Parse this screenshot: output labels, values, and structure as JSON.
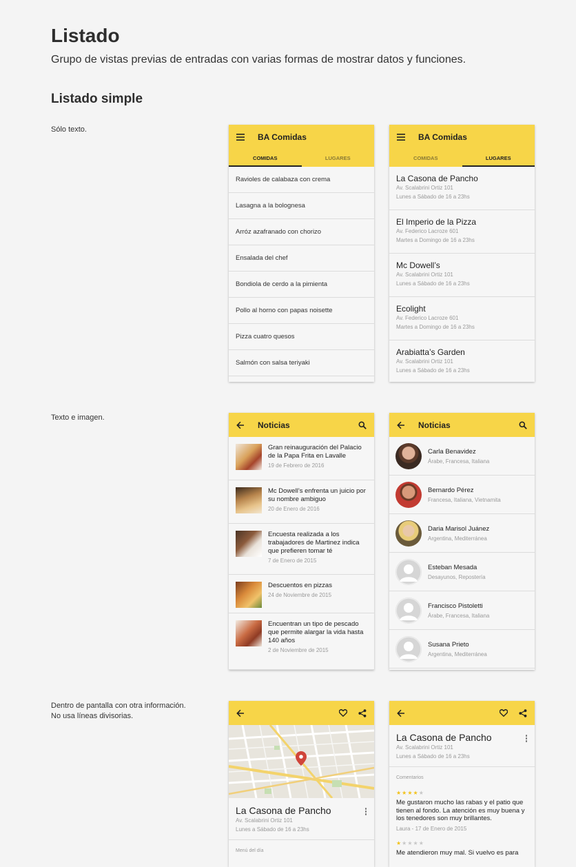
{
  "header": {
    "title": "Listado",
    "subtitle": "Grupo de vistas previas de entradas con varias formas de mostrar datos y funciones."
  },
  "section": {
    "title": "Listado simple"
  },
  "notes": {
    "text_only": "Sólo texto.",
    "text_image": "Texto e imagen.",
    "in_screen_1": "Dentro de pantalla con otra información.",
    "in_screen_2": "No usa líneas divisorias."
  },
  "colors": {
    "accent": "#f7d548",
    "background": "#f4f4f4",
    "star": "#f2c21a"
  },
  "phone1": {
    "title": "BA Comidas",
    "tabs": [
      "COMIDAS",
      "LUGARES"
    ],
    "items": [
      "Ravioles de calabaza con crema",
      "Lasagna a la bolognesa",
      "Arróz azafranado con chorizo",
      "Ensalada del chef",
      "Bondiola de cerdo a la pimienta",
      "Pollo al horno con papas noisette",
      "Pizza cuatro quesos",
      "Salmón con salsa teriyaki"
    ]
  },
  "phone2": {
    "title": "BA Comidas",
    "tabs": [
      "COMIDAS",
      "LUGARES"
    ],
    "items": [
      {
        "name": "La Casona de Pancho",
        "address": "Av. Scalabrini Ortiz 101",
        "hours": "Lunes a Sábado de 16 a 23hs"
      },
      {
        "name": "El Imperio de la Pizza",
        "address": "Av. Federico Lacroze 601",
        "hours": "Martes a Domingo de 16 a 23hs"
      },
      {
        "name": "Mc Dowell’s",
        "address": "Av. Scalabrini Ortiz 101",
        "hours": "Lunes a Sábado de 16 a 23hs"
      },
      {
        "name": "Ecolight",
        "address": "Av. Federico Lacroze 601",
        "hours": "Martes a Domingo de 16 a 23hs"
      },
      {
        "name": "Arabiatta’s Garden",
        "address": "Av. Scalabrini Ortiz 101",
        "hours": "Lunes a Sábado de 16 a 23hs"
      }
    ]
  },
  "phone3": {
    "title": "Noticias",
    "items": [
      {
        "title": "Gran reinauguración del Palacio de la Papa Frita en Lavalle",
        "date": "19 de Febrero de 2016"
      },
      {
        "title": "Mc Dowell’s enfrenta un juicio por su nombre ambiguo",
        "date": "20 de Enero de 2016"
      },
      {
        "title": "Encuesta realizada a los trabajadores de Martinez indica que prefieren tomar té",
        "date": "7 de Enero de 2015"
      },
      {
        "title": "Descuentos en pizzas",
        "date": "24 de Noviembre de 2015"
      },
      {
        "title": "Encuentran un tipo de pescado que permite alargar la vida hasta 140 años",
        "date": "2 de Noviembre de 2015"
      }
    ]
  },
  "phone4": {
    "title": "Noticias",
    "items": [
      {
        "name": "Carla Benavidez",
        "cuisines": "Árabe, Francesa, Italiana"
      },
      {
        "name": "Bernardo Pérez",
        "cuisines": "Francesa, Italiana, Vietnamita"
      },
      {
        "name": "Daria Marisol Juánez",
        "cuisines": "Argentina, Mediterránea"
      },
      {
        "name": "Esteban Mesada",
        "cuisines": "Desayunos, Repostería"
      },
      {
        "name": "Francisco Pistoletti",
        "cuisines": "Árabe, Francesa, Italiana"
      },
      {
        "name": "Susana Prieto",
        "cuisines": "Argentina, Mediterránea"
      }
    ]
  },
  "phone5": {
    "name": "La Casona de Pancho",
    "address": "Av. Scalabrini Ortiz 101",
    "hours": "Lunes a Sábado de 16 a 23hs",
    "menu_label": "Menú del día"
  },
  "phone6": {
    "name": "La Casona de Pancho",
    "address": "Av. Scalabrini Ortiz 101",
    "hours": "Lunes a Sábado de 16 a 23hs",
    "comments_label": "Comentarios",
    "comments": [
      {
        "rating": 4,
        "text": "Me gustaron mucho las rabas y el patio que tienen al fondo. La atención es muy buena y los tenedores son muy brillantes.",
        "meta": "Laura - 17 de Enero de 2015"
      },
      {
        "rating": 1,
        "text": "Me atendieron muy mal. Si vuelvo es para",
        "meta": ""
      }
    ]
  }
}
